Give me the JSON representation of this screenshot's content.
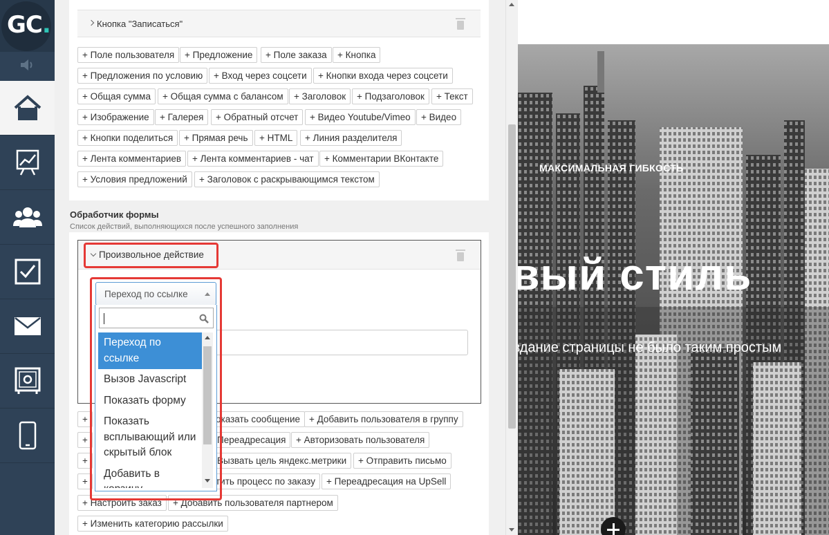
{
  "logo": {
    "text_main": "GC",
    "text_dot": "."
  },
  "sidebar": {
    "items": [
      {
        "icon": "home-icon",
        "active": true
      },
      {
        "icon": "chart-icon",
        "active": false
      },
      {
        "icon": "users-icon",
        "active": false
      },
      {
        "icon": "checkbox-icon",
        "active": false
      },
      {
        "icon": "mail-icon",
        "active": false
      },
      {
        "icon": "safe-icon",
        "active": false
      },
      {
        "icon": "mobile-icon",
        "active": false
      }
    ]
  },
  "block": {
    "label": "Кнопка \"Записаться\""
  },
  "field_chips": [
    "+ Поле пользователя",
    "+ Предложение",
    "+ Поле заказа",
    "+ Кнопка",
    "+ Предложения по условию",
    "+ Вход через соцсети",
    "+ Кнопки входа через соцсети",
    "+ Общая сумма",
    "+ Общая сумма с балансом",
    "+ Заголовок",
    "+ Подзаголовок",
    "+ Текст",
    "+ Изображение",
    "+ Галерея",
    "+ Обратный отсчет",
    "+ Видео Youtube/Vimeo",
    "+ Видео",
    "+ Кнопки поделиться",
    "+ Прямая речь",
    "+ HTML",
    "+ Линия разделителя",
    "+ Лента комментариев",
    "+ Лента комментариев - чат",
    "+ Комментарии ВКонтакте",
    "+ Условия предложений",
    "+ Заголовок с раскрывающимся текстом"
  ],
  "handler": {
    "title": "Обработчик формы",
    "subtitle": "Список действий, выполняющихся после успешного заполнения",
    "action_label": "Произвольное действие",
    "select_value": "Переход по ссылке",
    "search_value": "",
    "options": [
      "Переход по ссылке",
      "Вызов Javascript",
      "Показать форму",
      "Показать всплывающий или скрытый блок",
      "Добавить в корзину"
    ]
  },
  "action_chips": [
    "+ ",
    "оказать сообщение",
    "+ Добавить пользователя в группу",
    "+ ",
    "Переадресация",
    "+ Авторизовать пользователя",
    "+ ",
    "Вызвать цель яндекс.метрики",
    "+ Отправить письмо",
    "+ ",
    "тить процесс по заказу",
    "+ Переадресация на UpSell",
    "+ Настроить заказ",
    "+ Добавить пользователя партнером",
    "+ Изменить категорию рассылки"
  ],
  "preview": {
    "tagline": "МАКСИМАЛЬНАЯ ГИБКОСТЬ",
    "headline": "вый стиль",
    "subline": "здание страницы не было таким простым"
  },
  "colors": {
    "sidebar": "#2f4257",
    "highlight": "#e53935",
    "selected": "#3d8fd6",
    "accent": "#2ec4b6"
  }
}
